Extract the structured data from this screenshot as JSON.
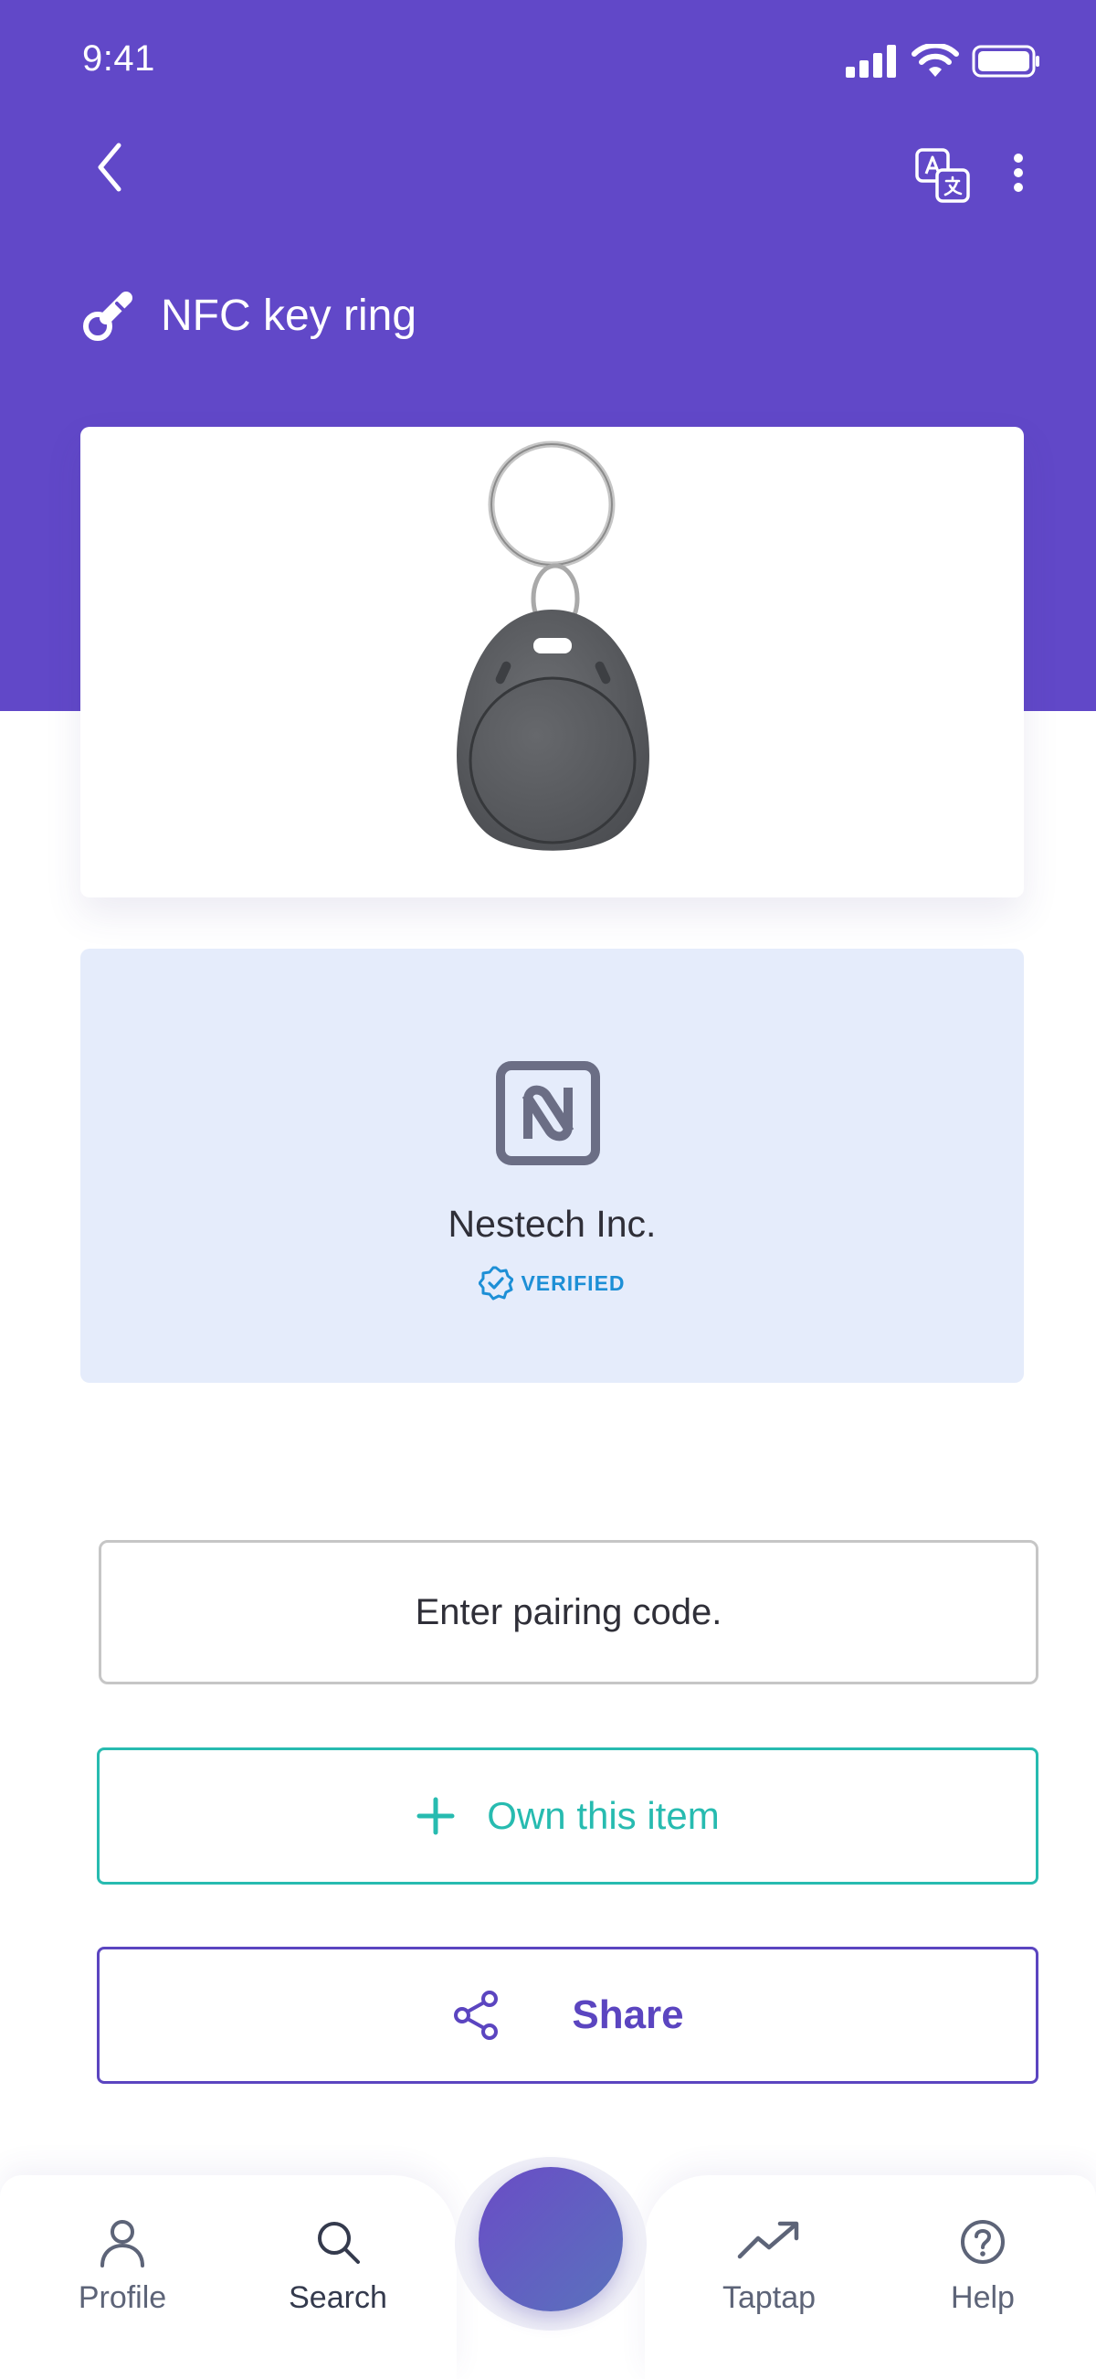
{
  "status_bar": {
    "time": "9:41"
  },
  "header": {
    "title": "NFC key ring"
  },
  "brand": {
    "name": "Nestech Inc.",
    "verified_label": "VERIFIED"
  },
  "pairing": {
    "placeholder": "Enter pairing code."
  },
  "actions": {
    "own_label": "Own this item",
    "share_label": "Share"
  },
  "nav": {
    "items": [
      {
        "label": "Profile",
        "icon": "person-icon"
      },
      {
        "label": "Search",
        "icon": "search-icon"
      },
      {
        "label": "Taptap",
        "icon": "trending-icon"
      },
      {
        "label": "Help",
        "icon": "help-icon"
      }
    ]
  },
  "colors": {
    "header": "#6148c8",
    "teal": "#27bbb0",
    "purple": "#5b45c0",
    "verified": "#1d8fd6",
    "brand_card": "#e5ecfb"
  }
}
